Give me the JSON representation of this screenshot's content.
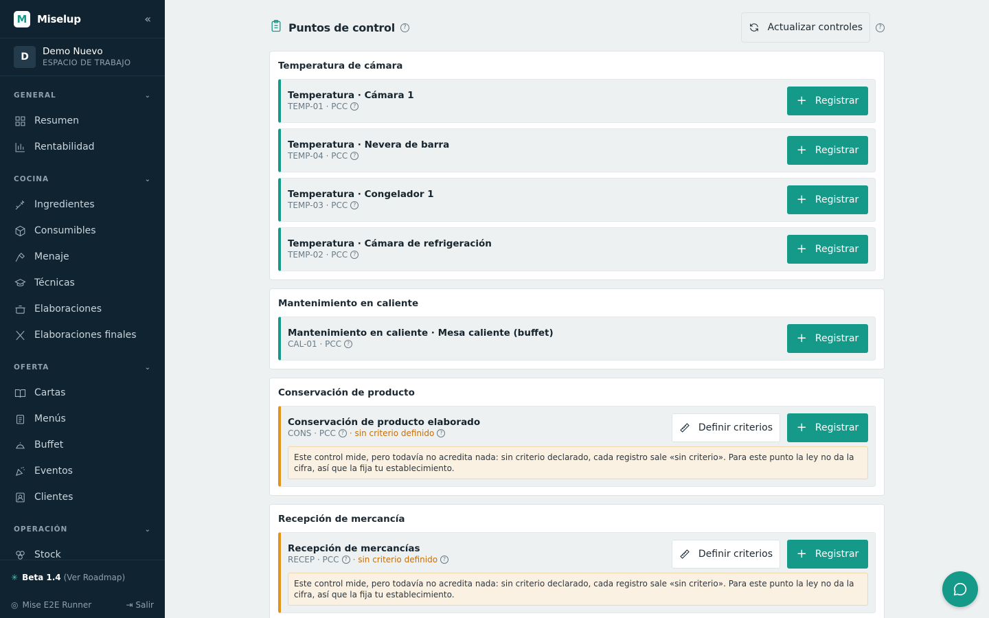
{
  "brand": {
    "name": "Miselup",
    "logo_letter": "M"
  },
  "workspace": {
    "initial": "D",
    "name": "Demo Nuevo",
    "subtitle": "ESPACIO DE TRABAJO"
  },
  "nav": [
    {
      "section": "GENERAL",
      "items": [
        {
          "label": "Resumen",
          "icon": "grid-icon"
        },
        {
          "label": "Rentabilidad",
          "icon": "bar-chart-icon"
        }
      ]
    },
    {
      "section": "COCINA",
      "items": [
        {
          "label": "Ingredientes",
          "icon": "carrot-icon"
        },
        {
          "label": "Consumibles",
          "icon": "box-icon"
        },
        {
          "label": "Menaje",
          "icon": "tools-icon"
        },
        {
          "label": "Técnicas",
          "icon": "graduation-icon"
        },
        {
          "label": "Elaboraciones",
          "icon": "pot-icon"
        },
        {
          "label": "Elaboraciones finales",
          "icon": "utensils-icon"
        }
      ]
    },
    {
      "section": "OFERTA",
      "items": [
        {
          "label": "Cartas",
          "icon": "book-icon"
        },
        {
          "label": "Menús",
          "icon": "clipboard-icon"
        },
        {
          "label": "Buffet",
          "icon": "cloche-icon"
        },
        {
          "label": "Eventos",
          "icon": "party-icon"
        },
        {
          "label": "Clientes",
          "icon": "contact-icon"
        }
      ]
    },
    {
      "section": "OPERACIÓN",
      "items": [
        {
          "label": "Stock",
          "icon": "boxes-icon"
        }
      ]
    }
  ],
  "footer": {
    "beta": "Beta 1.4",
    "roadmap": "(Ver Roadmap)",
    "user": "Mise E2E Runner",
    "logout": "Salir"
  },
  "header": {
    "title": "Puntos de control",
    "refresh_label": "Actualizar controles"
  },
  "labels": {
    "register": "Registrar",
    "criteria": "Definir criterios"
  },
  "groups": [
    {
      "title": "Temperatura de cámara",
      "controls": [
        {
          "name": "Temperatura · Cámara 1",
          "meta": "TEMP-01 · PCC",
          "warn": false
        },
        {
          "name": "Temperatura · Nevera de barra",
          "meta": "TEMP-04 · PCC",
          "warn": false
        },
        {
          "name": "Temperatura · Congelador 1",
          "meta": "TEMP-03 · PCC",
          "warn": false
        },
        {
          "name": "Temperatura · Cámara de refrigeración",
          "meta": "TEMP-02 · PCC",
          "warn": false
        }
      ]
    },
    {
      "title": "Mantenimiento en caliente",
      "controls": [
        {
          "name": "Mantenimiento en caliente · Mesa caliente (buffet)",
          "meta": "CAL-01 · PCC",
          "warn": false
        }
      ]
    },
    {
      "title": "Conservación de producto",
      "controls": [
        {
          "name": "Conservación de producto elaborado",
          "meta": "CONS · PCC",
          "warn": true,
          "warn_text": "· sin criterio definido",
          "note": "Este control mide, pero todavía no acredita nada: sin criterio declarado, cada registro sale «sin criterio». Para este punto la ley no da la cifra, así que la fija tu establecimiento."
        }
      ]
    },
    {
      "title": "Recepción de mercancía",
      "controls": [
        {
          "name": "Recepción de mercancías",
          "meta": "RECEP · PCC",
          "warn": true,
          "warn_text": "· sin criterio definido",
          "note": "Este control mide, pero todavía no acredita nada: sin criterio declarado, cada registro sale «sin criterio». Para este punto la ley no da la cifra, así que la fija tu establecimiento."
        }
      ]
    }
  ],
  "colors": {
    "sidebar": "#0f2330",
    "accent": "#159a8a",
    "warning": "#e0921a"
  }
}
